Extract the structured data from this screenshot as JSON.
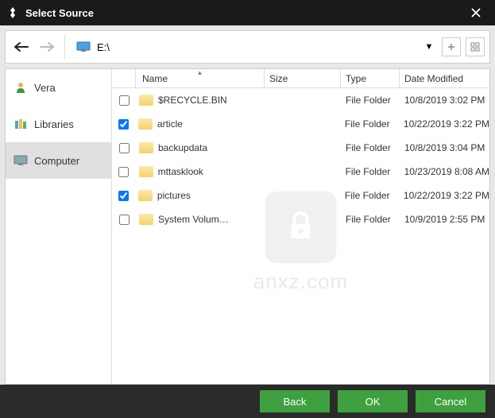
{
  "titlebar": {
    "title": "Select Source"
  },
  "toolbar": {
    "path": "E:\\"
  },
  "sidebar": {
    "items": [
      {
        "label": "Vera",
        "selected": false
      },
      {
        "label": "Libraries",
        "selected": false
      },
      {
        "label": "Computer",
        "selected": true
      }
    ]
  },
  "columns": {
    "name": "Name",
    "size": "Size",
    "type": "Type",
    "date": "Date Modified"
  },
  "files": [
    {
      "checked": false,
      "name": "$RECYCLE.BIN",
      "size": "",
      "type": "File Folder",
      "date": "10/8/2019 3:02 PM"
    },
    {
      "checked": true,
      "name": "article",
      "size": "",
      "type": "File Folder",
      "date": "10/22/2019 3:22 PM"
    },
    {
      "checked": false,
      "name": "backupdata",
      "size": "",
      "type": "File Folder",
      "date": "10/8/2019 3:04 PM"
    },
    {
      "checked": false,
      "name": "mttasklook",
      "size": "",
      "type": "File Folder",
      "date": "10/23/2019 8:08 AM"
    },
    {
      "checked": true,
      "name": "pictures",
      "size": "",
      "type": "File Folder",
      "date": "10/22/2019 3:22 PM"
    },
    {
      "checked": false,
      "name": "System Volum…",
      "size": "",
      "type": "File Folder",
      "date": "10/9/2019 2:55 PM"
    }
  ],
  "watermark": {
    "text": "anxz.com"
  },
  "footer": {
    "back": "Back",
    "ok": "OK",
    "cancel": "Cancel"
  }
}
